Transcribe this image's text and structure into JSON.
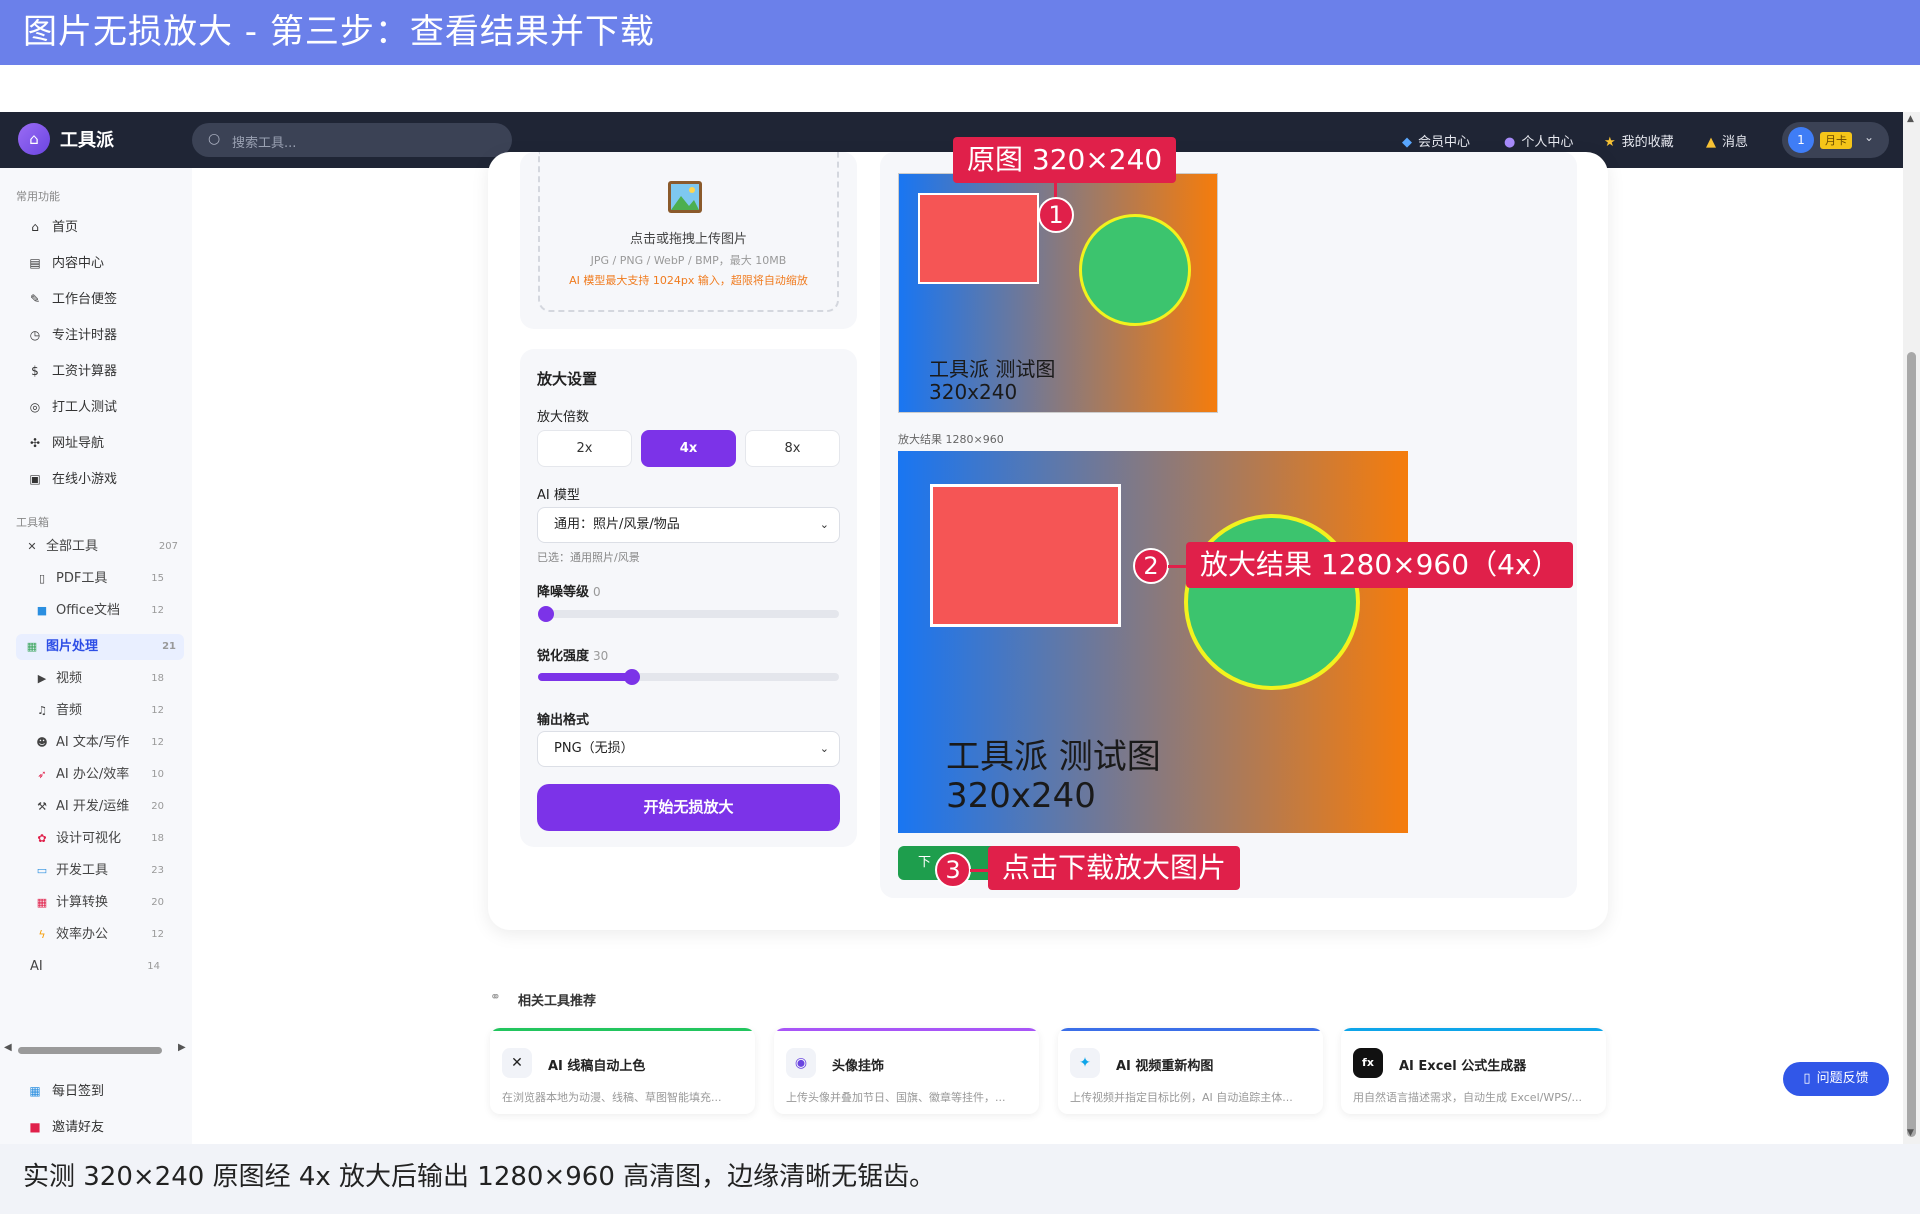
{
  "banner": {
    "title": "图片无损放大 - 第三步：查看结果并下载"
  },
  "caption": "实测 320×240 原图经 4x 放大后输出 1280×960 高清图，边缘清晰无锯齿。",
  "topnav": {
    "logo": "工具派",
    "search_placeholder": "搜索工具...",
    "links": [
      {
        "label": "会员中心",
        "icon": "diamond-icon"
      },
      {
        "label": "个人中心",
        "icon": "user-icon"
      },
      {
        "label": "我的收藏",
        "icon": "star-icon"
      },
      {
        "label": "消息",
        "icon": "bell-icon"
      }
    ],
    "user": {
      "avatar": "1",
      "badge": "月卡"
    }
  },
  "sidebar": {
    "section_common": "常用功能",
    "common": [
      {
        "label": "首页",
        "icon": "home-icon"
      },
      {
        "label": "内容中心",
        "icon": "newspaper-icon"
      },
      {
        "label": "工作台便签",
        "icon": "memo-icon"
      },
      {
        "label": "专注计时器",
        "icon": "stopwatch-icon"
      },
      {
        "label": "工资计算器",
        "icon": "money-bag-icon"
      },
      {
        "label": "打工人测试",
        "icon": "target-icon"
      },
      {
        "label": "网址导航",
        "icon": "compass-icon"
      },
      {
        "label": "在线小游戏",
        "icon": "gamepad-icon"
      }
    ],
    "section_tools": "工具箱",
    "all_tools": {
      "label": "全部工具",
      "count": "207"
    },
    "tools": [
      {
        "label": "PDF工具",
        "count": "15",
        "icon": "pdf-icon"
      },
      {
        "label": "Office文档",
        "count": "12",
        "icon": "office-icon"
      },
      {
        "label": "图片处理",
        "count": "21",
        "icon": "image-icon",
        "active": true
      },
      {
        "label": "视频",
        "count": "18",
        "icon": "video-icon"
      },
      {
        "label": "音频",
        "count": "12",
        "icon": "music-icon"
      },
      {
        "label": "AI 文本/写作",
        "count": "12",
        "icon": "robot-icon"
      },
      {
        "label": "AI 办公/效率",
        "count": "10",
        "icon": "rocket-icon"
      },
      {
        "label": "AI 开发/运维",
        "count": "20",
        "icon": "wrench-icon"
      },
      {
        "label": "设计可视化",
        "count": "18",
        "icon": "palette-icon"
      },
      {
        "label": "开发工具",
        "count": "23",
        "icon": "monitor-icon"
      },
      {
        "label": "计算转换",
        "count": "20",
        "icon": "calculator-icon"
      },
      {
        "label": "效率办公",
        "count": "12",
        "icon": "lightning-icon"
      },
      {
        "label": "AI",
        "count": "14",
        "icon": ""
      }
    ],
    "bottom": [
      {
        "label": "每日签到",
        "icon": "calendar-icon"
      },
      {
        "label": "邀请好友",
        "icon": "gift-icon"
      }
    ]
  },
  "upload": {
    "title": "点击或拖拽上传图片",
    "hint": "JPG / PNG / WebP / BMP，最大 10MB",
    "warn": "AI 模型最大支持 1024px 输入，超限将自动缩放"
  },
  "settings": {
    "title": "放大设置",
    "scale_label": "放大倍数",
    "scales": [
      "2x",
      "4x",
      "8x"
    ],
    "scale_selected": "4x",
    "model_label": "AI 模型",
    "model_value": "通用：照片/风景/物品",
    "model_selected_note": "已选：通用照片/风景",
    "denoise_label": "降噪等级",
    "denoise_value": "0",
    "sharpen_label": "锐化强度",
    "sharpen_value": "30",
    "format_label": "输出格式",
    "format_value": "PNG（无损）",
    "submit": "开始无损放大"
  },
  "result": {
    "orig_line1": "工具派 测试图",
    "orig_line2": "320x240",
    "caption": "放大结果 1280×960",
    "download": "下"
  },
  "callouts": [
    {
      "num": "1",
      "text": "原图 320×240"
    },
    {
      "num": "2",
      "text": "放大结果 1280×960（4x）"
    },
    {
      "num": "3",
      "text": "点击下载放大图片"
    }
  ],
  "related": {
    "title": "相关工具推荐",
    "cards": [
      {
        "name": "AI 线稿自动上色",
        "desc": "在浏览器本地为动漫、线稿、草图智能填充...",
        "color": "#22c55e",
        "icon": "tools-icon"
      },
      {
        "name": "头像挂饰",
        "desc": "上传头像并叠加节日、国旗、徽章等挂件，...",
        "color": "#a855f7",
        "icon": "avatar-frame-icon"
      },
      {
        "name": "AI 视频重新构图",
        "desc": "上传视频并指定目标比例，AI 自动追踪主体...",
        "color": "#3b6fe8",
        "icon": "sparkle-icon"
      },
      {
        "name": "AI Excel 公式生成器",
        "desc": "用自然语言描述需求，自动生成 Excel/WPS/...",
        "color": "#0ea5e9",
        "icon": "fx-icon"
      }
    ]
  },
  "feedback": "问题反馈"
}
